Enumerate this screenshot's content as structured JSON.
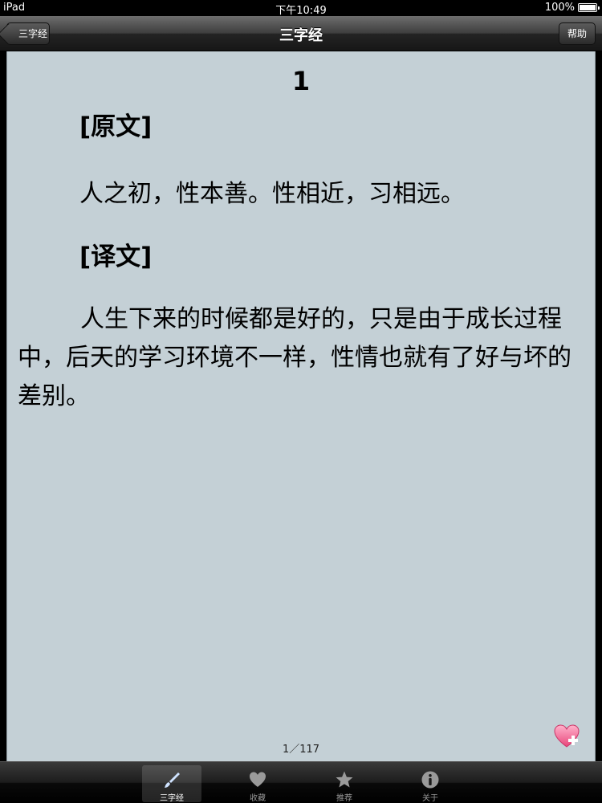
{
  "status_bar": {
    "carrier": "iPad",
    "time": "下午10:49",
    "battery": "100%"
  },
  "nav_bar": {
    "title": "三字经",
    "back_label": "三字经",
    "help_label": "帮助"
  },
  "content": {
    "chapter_number": "1",
    "original_heading": "[原文]",
    "original_text": "人之初，性本善。性相近，习相远。",
    "translation_heading": "[译文]",
    "translation_text": "人生下来的时候都是好的，只是由于成长过程中，后天的学习环境不一样，性情也就有了好与坏的差别。",
    "page_counter": "1／117"
  },
  "tab_bar": {
    "tabs": [
      {
        "label": "三字经",
        "icon": "brush-icon",
        "active": true
      },
      {
        "label": "收藏",
        "icon": "heart-icon",
        "active": false
      },
      {
        "label": "推荐",
        "icon": "star-icon",
        "active": false
      },
      {
        "label": "关于",
        "icon": "info-icon",
        "active": false
      }
    ]
  },
  "colors": {
    "content_background": "#c4d0d6",
    "bar_background": "#1c1c1c",
    "heart_pink": "#f06a95"
  }
}
